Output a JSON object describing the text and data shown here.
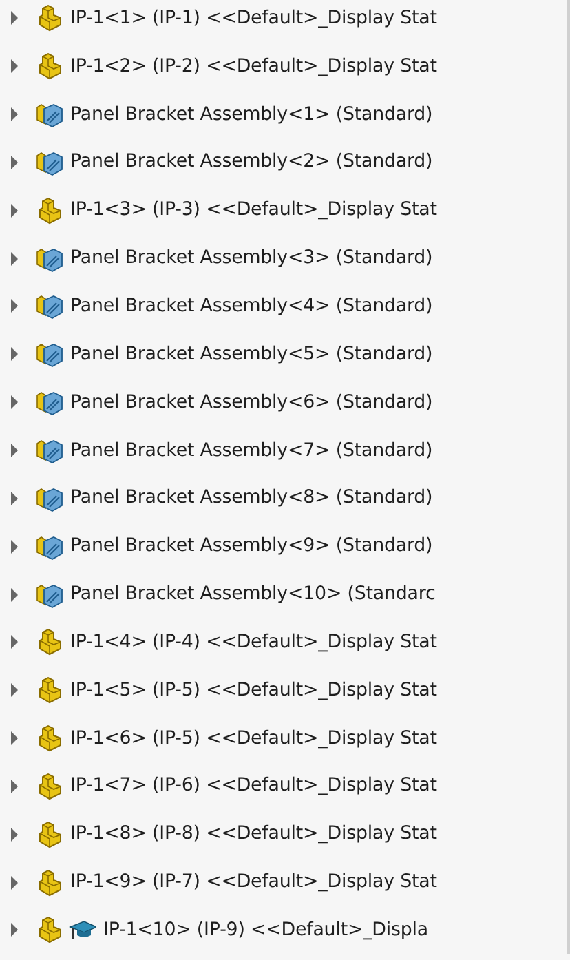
{
  "tree": {
    "items": [
      {
        "kind": "part",
        "label": "IP-1<1> (IP-1) <<Default>_Display Stat",
        "expanded": false
      },
      {
        "kind": "part",
        "label": "IP-1<2> (IP-2) <<Default>_Display Stat",
        "expanded": false
      },
      {
        "kind": "assembly",
        "label": "Panel Bracket Assembly<1> (Standard)",
        "expanded": false
      },
      {
        "kind": "assembly",
        "label": "Panel Bracket Assembly<2> (Standard)",
        "expanded": false
      },
      {
        "kind": "part",
        "label": "IP-1<3> (IP-3) <<Default>_Display Stat",
        "expanded": false
      },
      {
        "kind": "assembly",
        "label": "Panel Bracket Assembly<3> (Standard)",
        "expanded": false
      },
      {
        "kind": "assembly",
        "label": "Panel Bracket Assembly<4> (Standard)",
        "expanded": false
      },
      {
        "kind": "assembly",
        "label": "Panel Bracket Assembly<5> (Standard)",
        "expanded": false
      },
      {
        "kind": "assembly",
        "label": "Panel Bracket Assembly<6> (Standard)",
        "expanded": false
      },
      {
        "kind": "assembly",
        "label": "Panel Bracket Assembly<7> (Standard)",
        "expanded": false
      },
      {
        "kind": "assembly",
        "label": "Panel Bracket Assembly<8> (Standard)",
        "expanded": false
      },
      {
        "kind": "assembly",
        "label": "Panel Bracket Assembly<9> (Standard)",
        "expanded": false
      },
      {
        "kind": "assembly",
        "label": "Panel Bracket Assembly<10> (Standarc",
        "expanded": false
      },
      {
        "kind": "part",
        "label": "IP-1<4> (IP-4) <<Default>_Display Stat",
        "expanded": false
      },
      {
        "kind": "part",
        "label": "IP-1<5> (IP-5) <<Default>_Display Stat",
        "expanded": false
      },
      {
        "kind": "part",
        "label": "IP-1<6> (IP-5) <<Default>_Display Stat",
        "expanded": false
      },
      {
        "kind": "part",
        "label": "IP-1<7> (IP-6) <<Default>_Display Stat",
        "expanded": false
      },
      {
        "kind": "part",
        "label": "IP-1<8> (IP-8) <<Default>_Display Stat",
        "expanded": false
      },
      {
        "kind": "part",
        "label": "IP-1<9> (IP-7) <<Default>_Display Stat",
        "expanded": false
      },
      {
        "kind": "part_cap",
        "label": "IP-1<10> (IP-9) <<Default>_Displa",
        "expanded": false
      }
    ]
  }
}
